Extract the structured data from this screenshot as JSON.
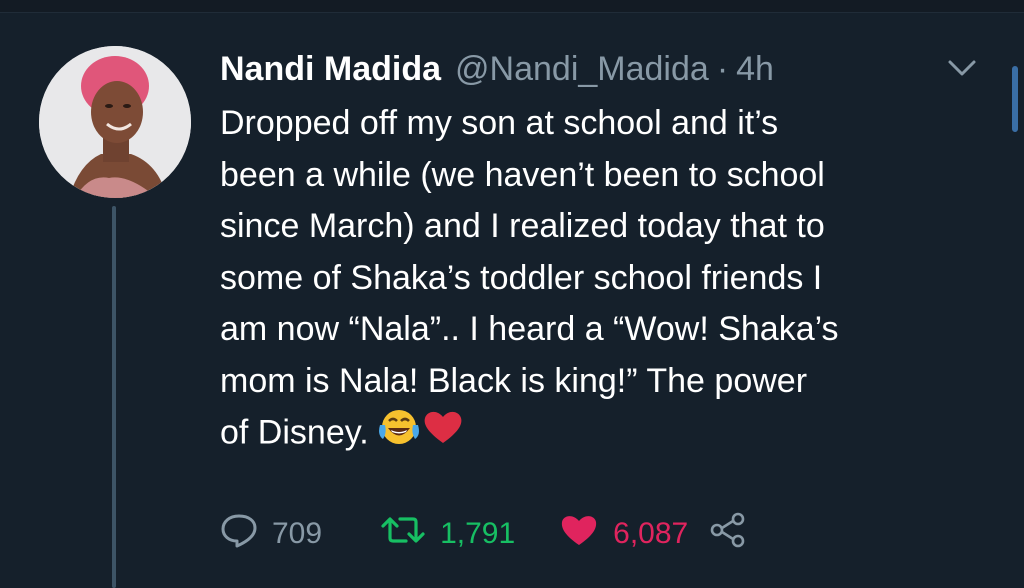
{
  "tweet": {
    "author_name": "Nandi Madida",
    "handle": "@Nandi_Madida",
    "separator": "·",
    "time": "4h",
    "text_lines": [
      "Dropped off my son at school and it’s",
      "been a while (we haven’t been to school",
      "since March) and I realized today that to",
      "some of Shaka’s toddler school friends I",
      "am now “Nala”.. I heard a “Wow! Shaka’s",
      "mom is Nala! Black is king!” The power",
      "of Disney."
    ],
    "emojis": [
      "face-with-tears-of-joy-icon",
      "red-heart-icon"
    ]
  },
  "actions": {
    "replies": "709",
    "retweets": "1,791",
    "likes": "6,087"
  },
  "colors": {
    "background": "#15202b",
    "secondary_text": "#8899a6",
    "retweet": "#17bf63",
    "like": "#e0245e",
    "thread_line": "#3d5466",
    "scroll_thumb": "#3a6ea5"
  }
}
